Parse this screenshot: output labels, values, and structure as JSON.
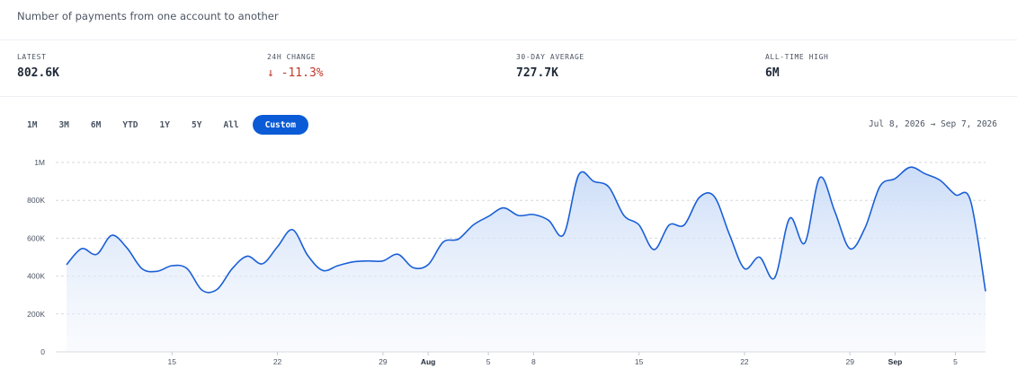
{
  "header": {
    "subtitle": "Number of payments from one account to another"
  },
  "stats": [
    {
      "label": "LATEST",
      "value": "802.6K"
    },
    {
      "label": "24H CHANGE",
      "value": "-11.3%",
      "icon": "arrow-down-icon",
      "color": "#c0392b"
    },
    {
      "label": "30-DAY AVERAGE",
      "value": "727.7K"
    },
    {
      "label": "ALL-TIME HIGH",
      "value": "6M"
    }
  ],
  "ranges": {
    "items": [
      "1M",
      "3M",
      "6M",
      "YTD",
      "1Y",
      "5Y",
      "All",
      "Custom"
    ],
    "active": "Custom"
  },
  "date_range": {
    "start": "Jul 8, 2026",
    "arrow": "→",
    "end": "Sep 7, 2026"
  },
  "colors": {
    "accent": "#0b5bd7",
    "line": "#1a5fd6",
    "fill_top": "#c9dbf7",
    "negative": "#c0392b"
  },
  "chart_data": {
    "type": "area",
    "xlabel": "",
    "ylabel": "",
    "ylim": [
      0,
      1000000
    ],
    "grid": true,
    "y_ticks": [
      {
        "value": 0,
        "label": "0"
      },
      {
        "value": 200000,
        "label": "200K"
      },
      {
        "value": 400000,
        "label": "400K"
      },
      {
        "value": 600000,
        "label": "600K"
      },
      {
        "value": 800000,
        "label": "800K"
      },
      {
        "value": 1000000,
        "label": "1M"
      }
    ],
    "x_ticks": [
      {
        "date": "2026-07-15",
        "label": "15",
        "bold": false
      },
      {
        "date": "2026-07-22",
        "label": "22",
        "bold": false
      },
      {
        "date": "2026-07-29",
        "label": "29",
        "bold": false
      },
      {
        "date": "2026-08-01",
        "label": "Aug",
        "bold": true
      },
      {
        "date": "2026-08-05",
        "label": "5",
        "bold": false
      },
      {
        "date": "2026-08-08",
        "label": "8",
        "bold": false
      },
      {
        "date": "2026-08-15",
        "label": "15",
        "bold": false
      },
      {
        "date": "2026-08-22",
        "label": "22",
        "bold": false
      },
      {
        "date": "2026-08-29",
        "label": "29",
        "bold": false
      },
      {
        "date": "2026-09-01",
        "label": "Sep",
        "bold": true
      },
      {
        "date": "2026-09-05",
        "label": "5",
        "bold": false
      }
    ],
    "series": [
      {
        "x": [
          "2026-07-08",
          "2026-07-09",
          "2026-07-10",
          "2026-07-11",
          "2026-07-12",
          "2026-07-13",
          "2026-07-14",
          "2026-07-15",
          "2026-07-16",
          "2026-07-17",
          "2026-07-18",
          "2026-07-19",
          "2026-07-20",
          "2026-07-21",
          "2026-07-22",
          "2026-07-23",
          "2026-07-24",
          "2026-07-25",
          "2026-07-26",
          "2026-07-27",
          "2026-07-28",
          "2026-07-29",
          "2026-07-30",
          "2026-07-31",
          "2026-08-01",
          "2026-08-02",
          "2026-08-03",
          "2026-08-04",
          "2026-08-05",
          "2026-08-06",
          "2026-08-07",
          "2026-08-08",
          "2026-08-09",
          "2026-08-10",
          "2026-08-11",
          "2026-08-12",
          "2026-08-13",
          "2026-08-14",
          "2026-08-15",
          "2026-08-16",
          "2026-08-17",
          "2026-08-18",
          "2026-08-19",
          "2026-08-20",
          "2026-08-21",
          "2026-08-22",
          "2026-08-23",
          "2026-08-24",
          "2026-08-25",
          "2026-08-26",
          "2026-08-27",
          "2026-08-28",
          "2026-08-29",
          "2026-08-30",
          "2026-08-31",
          "2026-09-01",
          "2026-09-02",
          "2026-09-03",
          "2026-09-04",
          "2026-09-05",
          "2026-09-06",
          "2026-09-07"
        ],
        "values": [
          460000,
          545000,
          515000,
          615000,
          550000,
          440000,
          425000,
          455000,
          440000,
          325000,
          330000,
          440000,
          505000,
          465000,
          555000,
          645000,
          510000,
          430000,
          455000,
          475000,
          480000,
          480000,
          515000,
          445000,
          460000,
          580000,
          595000,
          670000,
          715000,
          760000,
          720000,
          725000,
          695000,
          620000,
          935000,
          900000,
          870000,
          720000,
          670000,
          540000,
          670000,
          670000,
          815000,
          820000,
          620000,
          440000,
          500000,
          390000,
          705000,
          575000,
          920000,
          740000,
          545000,
          655000,
          875000,
          915000,
          975000,
          940000,
          905000,
          830000,
          800000,
          320000
        ]
      }
    ]
  }
}
